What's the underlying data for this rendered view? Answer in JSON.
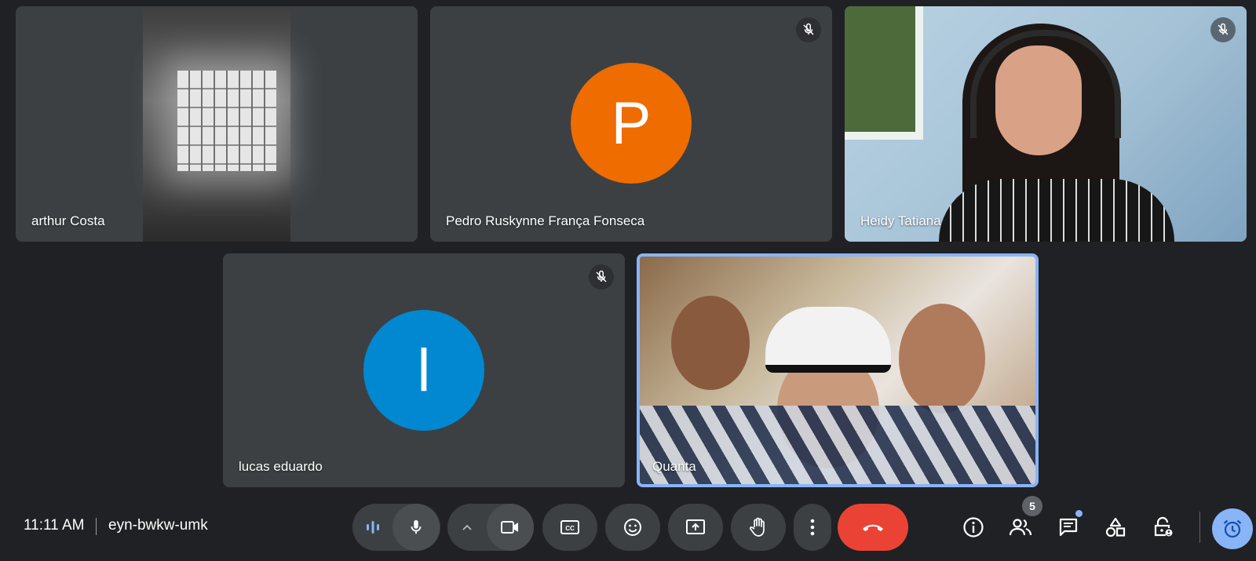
{
  "participants": [
    {
      "name": "arthur Costa",
      "type": "video"
    },
    {
      "name": "Pedro Ruskynne França Fonseca",
      "type": "avatar",
      "initial": "P",
      "avatar_color": "#ee6c00",
      "muted": true
    },
    {
      "name": "Heidy Tatiana",
      "type": "video",
      "muted": true
    },
    {
      "name": "lucas eduardo",
      "type": "avatar",
      "initial": "l",
      "avatar_color": "#0288d1",
      "muted": true
    },
    {
      "name": "Quanta",
      "type": "video",
      "active_speaker": true,
      "highlight_color": "#8ab4f8"
    }
  ],
  "meeting": {
    "time": "11:11 AM",
    "code": "eyn-bwkw-umk"
  },
  "controls": {
    "people_count": "5",
    "end_call_color": "#ea4335",
    "accent_color": "#8ab4f8"
  }
}
